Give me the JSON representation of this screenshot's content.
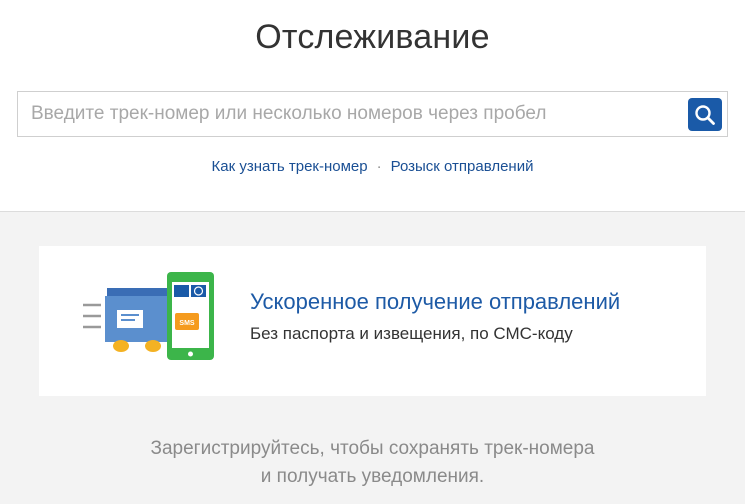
{
  "page": {
    "title": "Отслеживание"
  },
  "search": {
    "placeholder": "Введите трек-номер или несколько номеров через пробел",
    "button_icon": "search-icon"
  },
  "links": {
    "how_to_find": "Как узнать трек-номер",
    "separator": "·",
    "search_shipments": "Розыск отправлений"
  },
  "promo": {
    "title": "Ускоренное получение отправлений",
    "subtitle": "Без паспорта и извещения, по СМС-коду",
    "icon": "phone-sms-parcel-icon",
    "sms_label": "SMS"
  },
  "register": {
    "line1": "Зарегистрируйтесь, чтобы сохранять трек-номера",
    "line2": "и получать уведомления."
  },
  "colors": {
    "accent": "#1a5aa8",
    "link": "#1a4f94",
    "promo_title": "#1d5aa6",
    "phone_green": "#3cb54a",
    "parcel_blue": "#5b8fce",
    "wheel_yellow": "#f4b223",
    "sms_orange": "#f59b1e"
  }
}
